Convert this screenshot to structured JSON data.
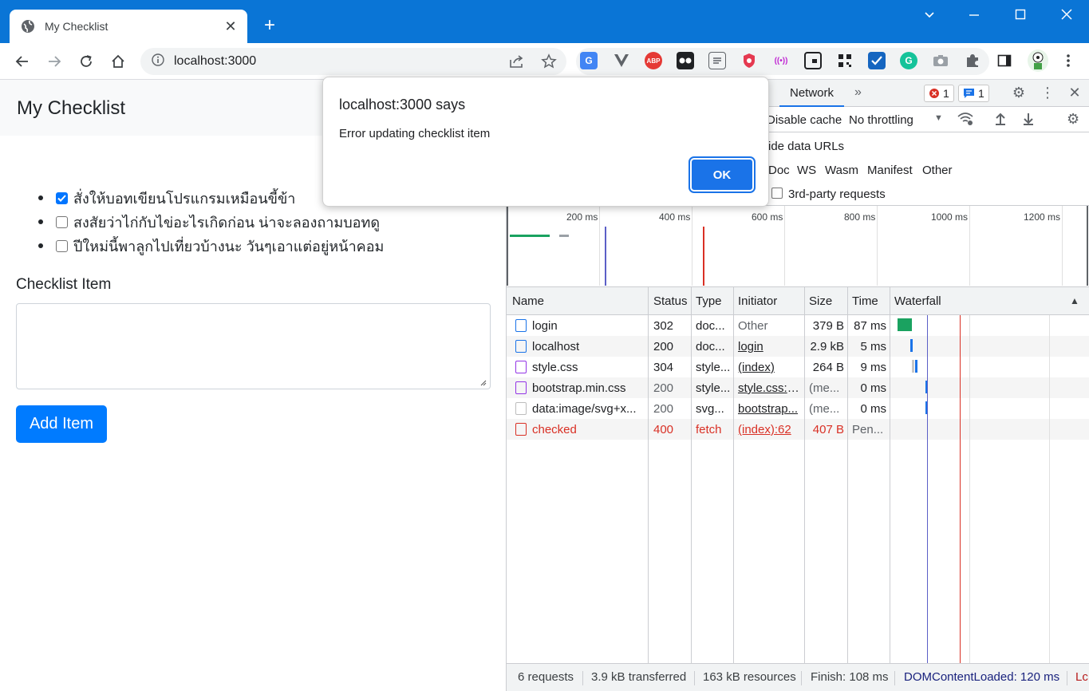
{
  "browser": {
    "tab_title": "My Checklist",
    "url": "localhost:3000",
    "extensions": [
      "google-translate-icon",
      "vue-devtools-icon",
      "adblock-icon",
      "tampermonkey-icon",
      "reader-icon",
      "shield-icon",
      "podcast-icon",
      "pip-icon",
      "qr-icon",
      "todo-icon",
      "grammarly-icon",
      "camera-icon",
      "puzzle-icon"
    ],
    "ext_labels": {
      "abp": "ABP",
      "grammarly": "G"
    }
  },
  "page": {
    "title": "My Checklist",
    "items": [
      {
        "text": "สั่งให้บอทเขียนโปรแกรมเหมือนขี้ข้า",
        "checked": true
      },
      {
        "text": "สงสัยว่าไก่กับไข่อะไรเกิดก่อน น่าจะลองถามบอทดู",
        "checked": false
      },
      {
        "text": "ปีใหม่นี้พาลูกไปเที่ยวบ้างนะ วันๆเอาแต่อยู่หน้าคอม",
        "checked": false
      }
    ],
    "input_label": "Checklist Item",
    "add_button": "Add Item"
  },
  "alert": {
    "title": "localhost:3000 says",
    "message": "Error updating checklist item",
    "ok": "OK"
  },
  "devtools": {
    "network_tab": "Network",
    "more_tabs": "»",
    "errors_count": "1",
    "messages_count": "1",
    "disable_cache": "Disable cache",
    "throttling": "No throttling",
    "hide_data_urls": "ide data URLs",
    "filters": [
      "Doc",
      "WS",
      "Wasm",
      "Manifest",
      "Other"
    ],
    "third_party": "3rd-party requests",
    "timeline_ticks": [
      "200 ms",
      "400 ms",
      "600 ms",
      "800 ms",
      "1000 ms",
      "1200 ms"
    ],
    "columns": [
      "Name",
      "Status",
      "Type",
      "Initiator",
      "Size",
      "Time",
      "Waterfall"
    ],
    "rows": [
      {
        "name": "login",
        "status": "302",
        "type": "doc...",
        "initiator": "Other",
        "size": "379 B",
        "time": "87 ms",
        "kind": "doc"
      },
      {
        "name": "localhost",
        "status": "200",
        "type": "doc...",
        "initiator": "login",
        "size": "2.9 kB",
        "time": "5 ms",
        "kind": "doc"
      },
      {
        "name": "style.css",
        "status": "304",
        "type": "style...",
        "initiator": "(index)",
        "size": "264 B",
        "time": "9 ms",
        "kind": "css"
      },
      {
        "name": "bootstrap.min.css",
        "status": "200",
        "type": "style...",
        "initiator": "style.css:-l...",
        "size": "(me...",
        "time": "0 ms",
        "kind": "css"
      },
      {
        "name": "data:image/svg+x...",
        "status": "200",
        "type": "svg...",
        "initiator": "bootstrap...",
        "size": "(me...",
        "time": "0 ms",
        "kind": "img"
      },
      {
        "name": "checked",
        "status": "400",
        "type": "fetch",
        "initiator": "(index):62",
        "size": "407 B",
        "time": "Pen...",
        "kind": "err"
      }
    ],
    "status": {
      "requests": "6 requests",
      "transferred": "3.9 kB transferred",
      "resources": "163 kB resources",
      "finish": "Finish: 108 ms",
      "dcl": "DOMContentLoaded: 120 ms",
      "load": "Lc"
    }
  }
}
